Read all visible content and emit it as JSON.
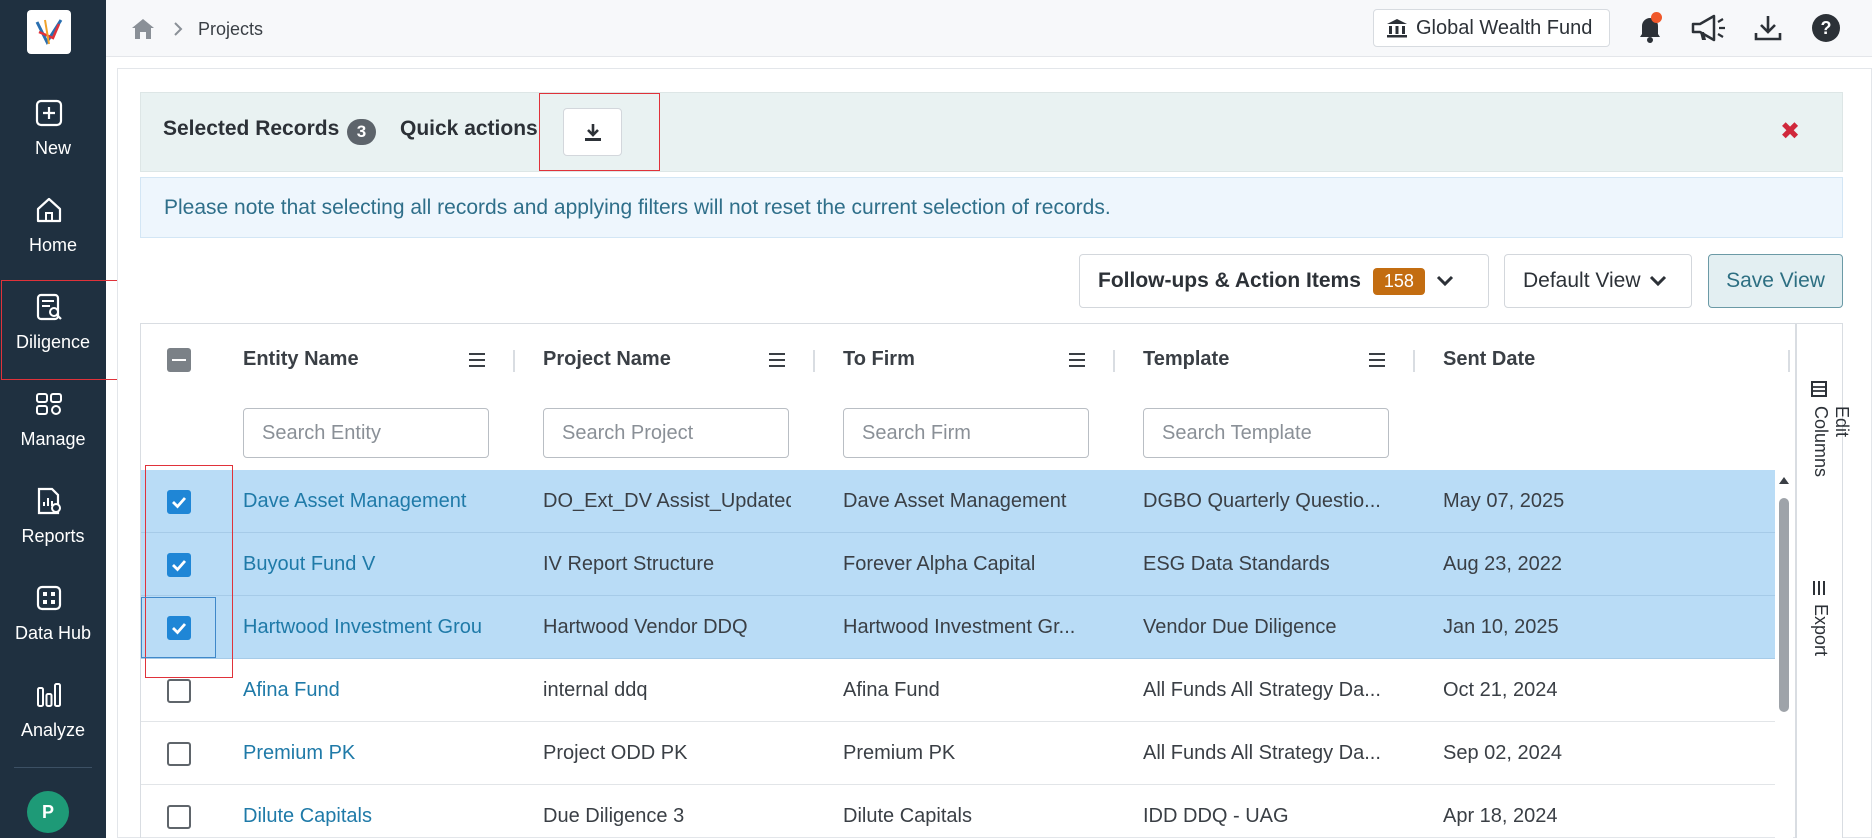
{
  "sidebar": {
    "logo_icon": "app-logo-icon",
    "items": [
      {
        "label": "New",
        "icon": "plus-square-icon"
      },
      {
        "label": "Home",
        "icon": "home-icon"
      },
      {
        "label": "Diligence",
        "icon": "diligence-icon"
      },
      {
        "label": "Manage",
        "icon": "manage-icon"
      },
      {
        "label": "Reports",
        "icon": "reports-icon"
      },
      {
        "label": "Data Hub",
        "icon": "data-hub-icon"
      },
      {
        "label": "Analyze",
        "icon": "bar-chart-icon"
      }
    ],
    "avatar_initial": "P"
  },
  "header": {
    "breadcrumb": "Projects",
    "fund_name": "Global Wealth Fund",
    "icons": [
      "home-icon",
      "bell-icon",
      "megaphone-icon",
      "download-icon",
      "help-icon"
    ]
  },
  "selection": {
    "title": "Selected Records",
    "count": "3",
    "quick_actions": "Quick actions",
    "close": "✖"
  },
  "notice": "Please note that selecting all records and applying filters will not reset the current selection of records.",
  "toolbar": {
    "follow_label": "Follow-ups & Action Items",
    "follow_count": "158",
    "view_label": "Default View",
    "save_label": "Save View"
  },
  "table": {
    "columns": [
      {
        "label": "Entity Name",
        "placeholder": "Search Entity"
      },
      {
        "label": "Project Name",
        "placeholder": "Search Project"
      },
      {
        "label": "To Firm",
        "placeholder": "Search Firm"
      },
      {
        "label": "Template",
        "placeholder": "Search Template"
      },
      {
        "label": "Sent Date",
        "placeholder": ""
      }
    ],
    "rows": [
      {
        "checked": true,
        "entity": "Dave Asset Management",
        "project": "DO_Ext_DV Assist_Updated",
        "firm": "Dave Asset Management",
        "template": "DGBO Quarterly Questio...",
        "date": "May 07, 2025"
      },
      {
        "checked": true,
        "entity": "Buyout Fund V",
        "project": "IV Report Structure",
        "firm": "Forever Alpha Capital",
        "template": "ESG Data Standards",
        "date": "Aug 23, 2022"
      },
      {
        "checked": true,
        "entity": "Hartwood Investment Group",
        "project": "Hartwood Vendor DDQ",
        "firm": "Hartwood Investment Gr...",
        "template": "Vendor Due Diligence",
        "date": "Jan 10, 2025"
      },
      {
        "checked": false,
        "entity": "Afina Fund",
        "project": "internal ddq",
        "firm": "Afina Fund",
        "template": "All Funds All Strategy Da...",
        "date": "Oct 21, 2024"
      },
      {
        "checked": false,
        "entity": "Premium PK",
        "project": "Project ODD PK",
        "firm": "Premium PK",
        "template": "All Funds All Strategy Da...",
        "date": "Sep 02, 2024"
      },
      {
        "checked": false,
        "entity": "Dilute Capitals",
        "project": "Due Diligence 3",
        "firm": "Dilute Capitals",
        "template": "IDD DDQ - UAG",
        "date": "Apr 18, 2024"
      }
    ]
  },
  "side_panel": {
    "edit_columns": "Edit Columns",
    "export": "Export"
  },
  "colors": {
    "sidebar_bg": "#1f3040",
    "selected_row": "#b9dcf6",
    "link": "#1f7aa8",
    "badge_orange": "#c36d11",
    "checkbox_blue": "#1f86d6",
    "highlight_red": "#e0323a"
  }
}
